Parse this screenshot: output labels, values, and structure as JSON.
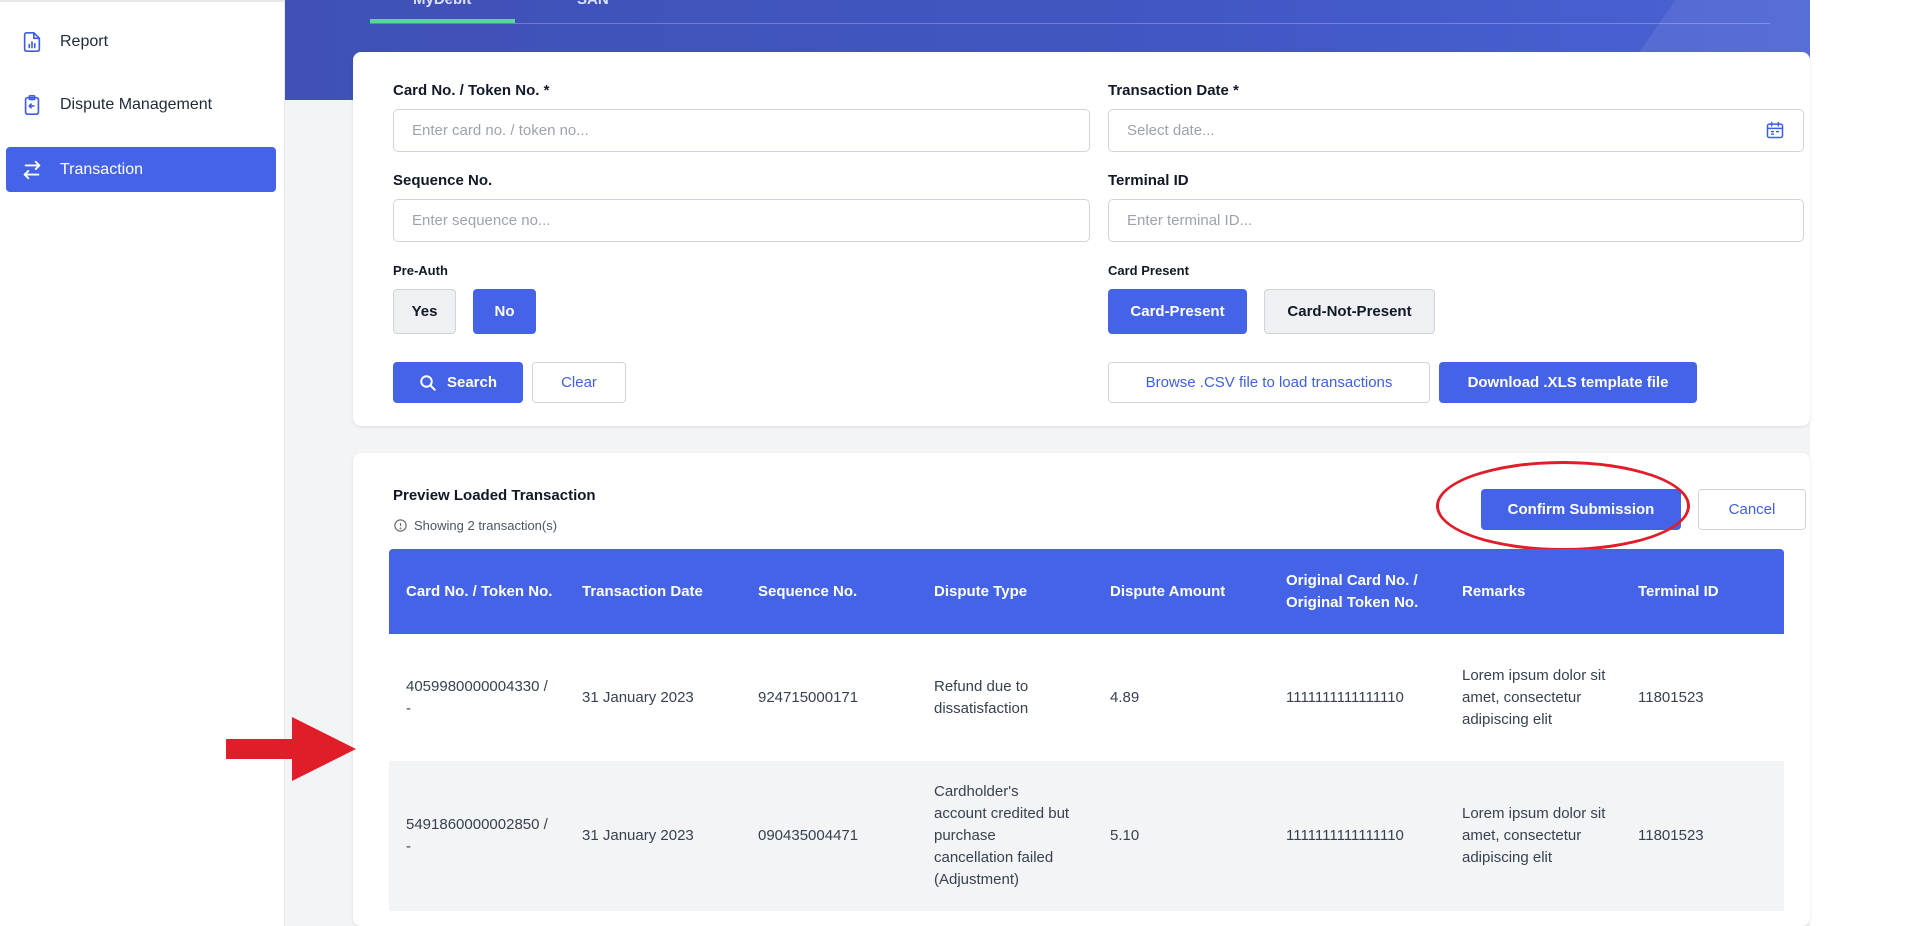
{
  "sidebar": {
    "items": [
      {
        "label": "Report",
        "icon": "report-icon"
      },
      {
        "label": "Dispute Management",
        "icon": "clipboard-icon"
      },
      {
        "label": "Transaction",
        "icon": "transfer-arrows-icon",
        "active": true
      }
    ]
  },
  "tabs": [
    {
      "label": "MyDebit",
      "active": true
    },
    {
      "label": "SAN"
    }
  ],
  "form": {
    "card_no": {
      "label": "Card No. / Token No. *",
      "placeholder": "Enter card no. / token no..."
    },
    "transaction_date": {
      "label": "Transaction Date *",
      "placeholder": "Select date..."
    },
    "sequence_no": {
      "label": "Sequence No.",
      "placeholder": "Enter sequence no..."
    },
    "terminal_id": {
      "label": "Terminal ID",
      "placeholder": "Enter terminal ID..."
    },
    "pre_auth": {
      "label": "Pre-Auth",
      "options": [
        "Yes",
        "No"
      ],
      "selected": "No"
    },
    "card_present": {
      "label": "Card Present",
      "options": [
        "Card-Present",
        "Card-Not-Present"
      ],
      "selected": "Card-Present"
    },
    "search_label": "Search",
    "clear_label": "Clear",
    "browse_label": "Browse .CSV file to load transactions",
    "download_label": "Download .XLS template file"
  },
  "preview": {
    "title": "Preview Loaded Transaction",
    "count_text": "Showing 2 transaction(s)",
    "confirm_label": "Confirm Submission",
    "cancel_label": "Cancel",
    "columns": [
      "Card No. / Token No.",
      "Transaction Date",
      "Sequence No.",
      "Dispute Type",
      "Dispute Amount",
      "Original Card No. / Original Token No.",
      "Remarks",
      "Terminal ID"
    ],
    "rows": [
      [
        "4059980000004330 / -",
        "31 January 2023",
        "924715000171",
        "Refund due to dissatisfaction",
        "4.89",
        "1111111111111110",
        "Lorem ipsum dolor sit amet, consectetur adipiscing elit",
        "11801523"
      ],
      [
        "5491860000002850 / -",
        "31 January 2023",
        "090435004471",
        "Cardholder's account credited but purchase cancellation failed (Adjustment)",
        "5.10",
        "1111111111111110",
        "Lorem ipsum dolor sit amet, consectetur adipiscing elit",
        "11801523"
      ]
    ]
  },
  "colors": {
    "primary": "#4463e6",
    "banner": "#3f51b5",
    "tab_underline": "#5dd39e",
    "annotation": "#e11d2a"
  }
}
